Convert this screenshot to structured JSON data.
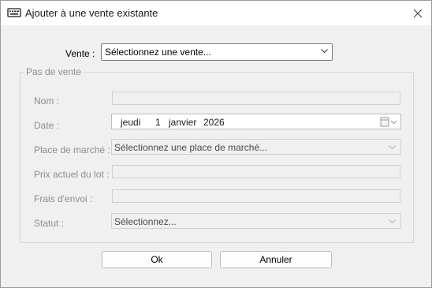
{
  "window": {
    "title": "Ajouter à une vente existante"
  },
  "vente": {
    "label": "Vente :",
    "selected": "Sélectionnez une vente..."
  },
  "group": {
    "legend": "Pas de vente"
  },
  "fields": {
    "nom": {
      "label": "Nom :",
      "value": ""
    },
    "date": {
      "label": "Date :",
      "weekday": "jeudi",
      "day": "1",
      "month": "janvier",
      "year": "2026"
    },
    "place": {
      "label": "Place de marché :",
      "selected": "Sélectionnez une place de marché..."
    },
    "prix": {
      "label": "Prix actuel du lot :",
      "value": ""
    },
    "frais": {
      "label": "Frais d'envoi :",
      "value": ""
    },
    "statut": {
      "label": "Statut :",
      "selected": "Sélectionnez..."
    }
  },
  "buttons": {
    "ok": "Ok",
    "cancel": "Annuler"
  },
  "icons": {
    "app": "keyboard-icon",
    "close": "close-icon",
    "dropdown": "chevron-down-icon",
    "calendar": "calendar-icon"
  }
}
